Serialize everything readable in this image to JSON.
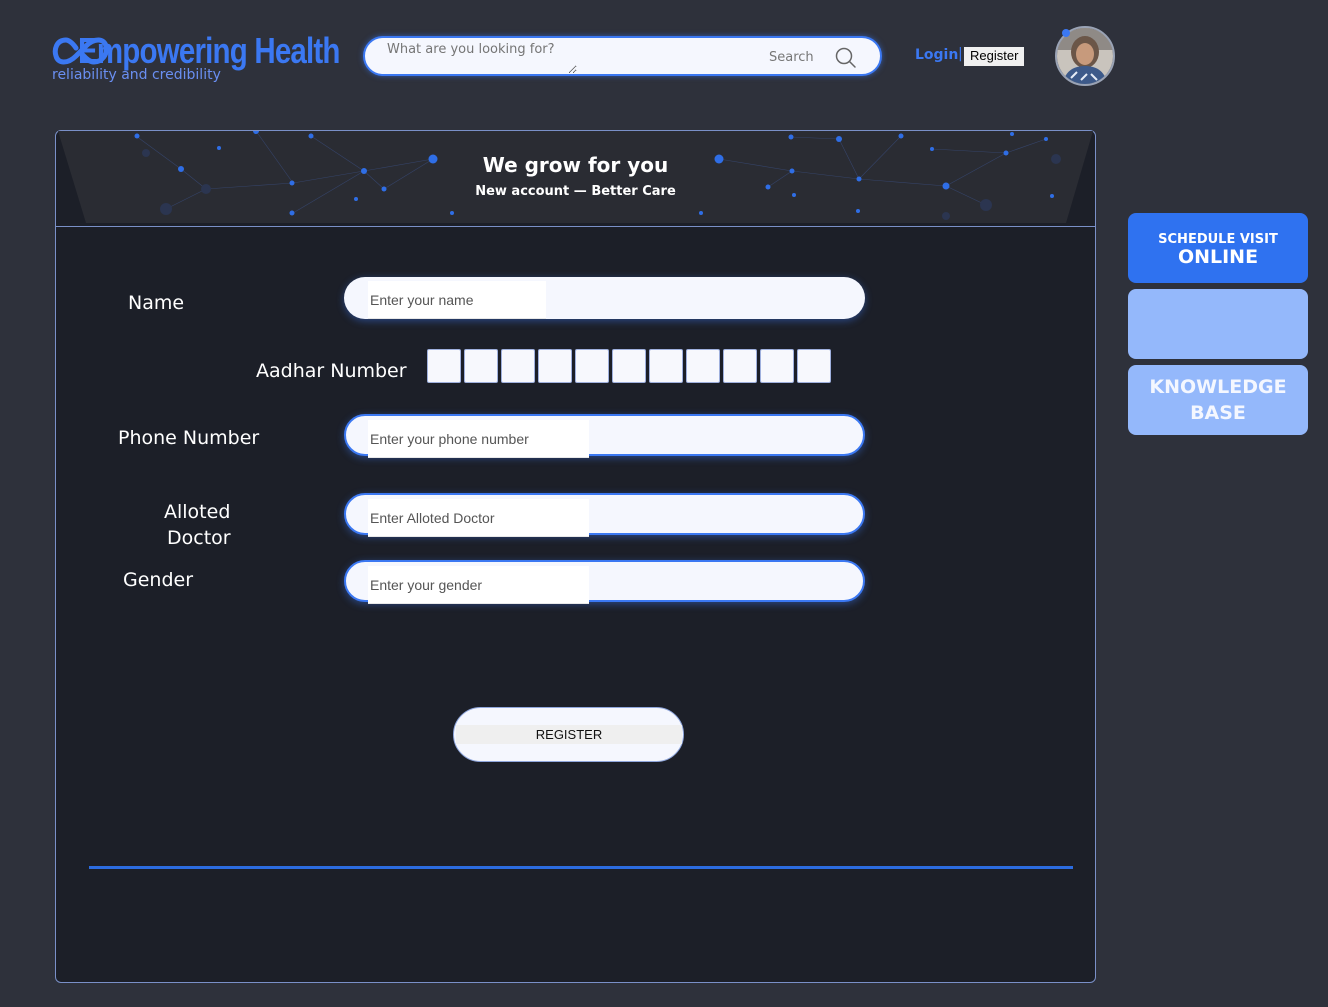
{
  "header": {
    "logo_title": "Empowering Health",
    "logo_tagline": "reliability and credibility",
    "search_placeholder": "What are you looking for?",
    "search_label": "Search",
    "login_label": "Login",
    "separator": "|",
    "register_label": "Register"
  },
  "banner": {
    "title": "We grow for you",
    "subtitle": "New account — Better Care"
  },
  "form": {
    "name_label": "Name",
    "name_placeholder": "Enter your name",
    "aadhar_label": "Aadhar Number",
    "aadhar_box_count": 11,
    "phone_label": "Phone Number",
    "phone_placeholder": "Enter your phone number",
    "doctor_label_line1": "Alloted",
    "doctor_label_line2": "Doctor",
    "doctor_placeholder": "Enter Alloted Doctor",
    "gender_label": "Gender",
    "gender_placeholder": "Enter your gender",
    "register_button": "REGISTER"
  },
  "side": {
    "schedule_top": "SCHEDULE VISIT",
    "schedule_bottom": "ONLINE",
    "blank": "",
    "kb_line1": "KNOWLEDGE",
    "kb_line2": "BASE"
  },
  "colors": {
    "background": "#2e313b",
    "card": "#1c1f28",
    "accent": "#3b78f2",
    "side_light": "#94b8fb"
  }
}
